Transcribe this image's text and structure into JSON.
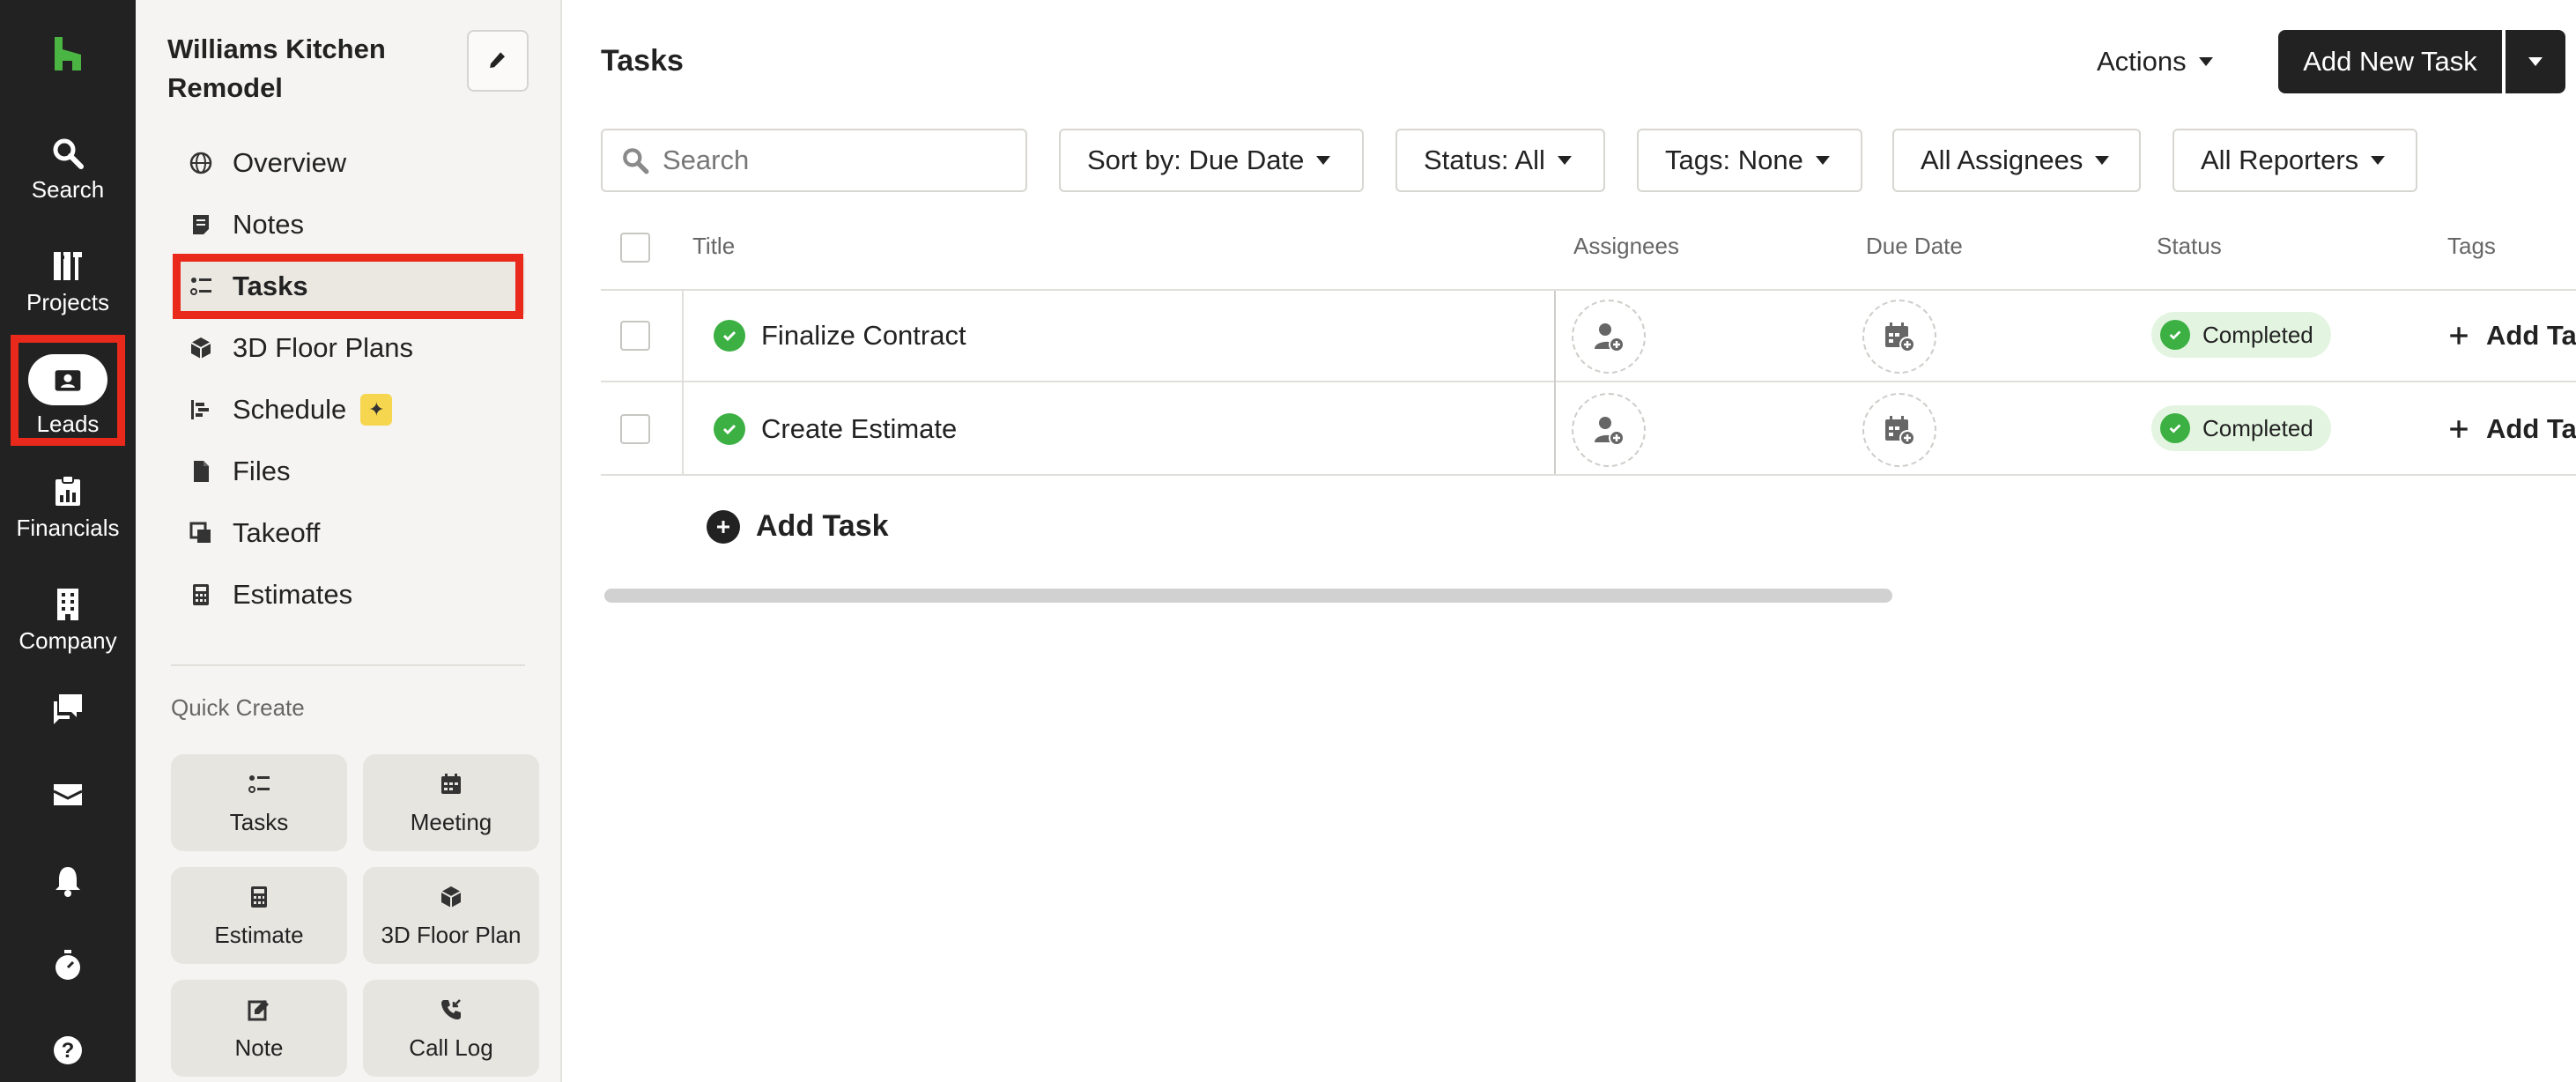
{
  "rail": {
    "items": [
      {
        "label": "Search",
        "icon": "search-icon"
      },
      {
        "label": "Projects",
        "icon": "projects-icon"
      },
      {
        "label": "Leads",
        "icon": "leads-icon"
      },
      {
        "label": "Financials",
        "icon": "financials-icon"
      },
      {
        "label": "Company",
        "icon": "company-icon"
      }
    ],
    "icon_only": [
      "chat-icon",
      "inbox-icon",
      "bell-icon",
      "timer-icon",
      "help-icon"
    ],
    "brand_color": "#4bb543"
  },
  "sidebar": {
    "project_title": "Williams Kitchen Remodel",
    "nav": [
      {
        "label": "Overview",
        "icon": "globe-icon"
      },
      {
        "label": "Notes",
        "icon": "notes-icon"
      },
      {
        "label": "Tasks",
        "icon": "tasks-icon"
      },
      {
        "label": "3D Floor Plans",
        "icon": "cube-icon"
      },
      {
        "label": "Schedule",
        "icon": "schedule-icon"
      },
      {
        "label": "Files",
        "icon": "file-icon"
      },
      {
        "label": "Takeoff",
        "icon": "takeoff-icon"
      },
      {
        "label": "Estimates",
        "icon": "calculator-icon"
      }
    ],
    "quick_create_label": "Quick Create",
    "quick_create": [
      {
        "label": "Tasks",
        "icon": "tasks-icon"
      },
      {
        "label": "Meeting",
        "icon": "calendar-icon"
      },
      {
        "label": "Estimate",
        "icon": "calculator-icon"
      },
      {
        "label": "3D Floor Plan",
        "icon": "cube-icon"
      },
      {
        "label": "Note",
        "icon": "note-edit-icon"
      },
      {
        "label": "Call Log",
        "icon": "phone-icon"
      }
    ]
  },
  "main": {
    "title": "Tasks",
    "actions_label": "Actions",
    "add_new_task_label": "Add New Task",
    "search_placeholder": "Search",
    "filters": [
      "Sort by: Due Date",
      "Status: All",
      "Tags: None",
      "All Assignees",
      "All Reporters"
    ],
    "columns": [
      "Title",
      "Assignees",
      "Due Date",
      "Status",
      "Tags"
    ],
    "rows": [
      {
        "title": "Finalize Contract",
        "status": "Completed",
        "tags_action": "Add Ta"
      },
      {
        "title": "Create Estimate",
        "status": "Completed",
        "tags_action": "Add Ta"
      }
    ],
    "add_task_label": "Add Task"
  },
  "colors": {
    "highlight": "#e8291b",
    "status_completed": "#3cb043",
    "status_completed_bg": "#e3f5e1",
    "dark": "#222222"
  }
}
